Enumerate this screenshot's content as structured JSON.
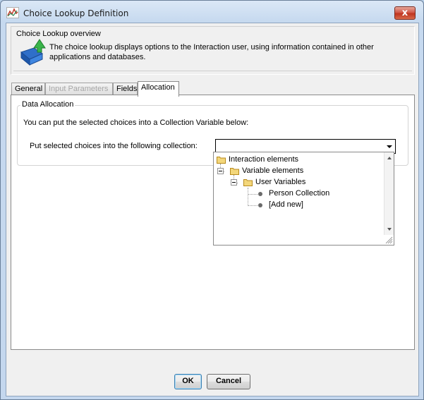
{
  "window": {
    "title": "Choice Lookup Definition",
    "close_glyph": "x"
  },
  "overview": {
    "title": "Choice Lookup overview",
    "text": "The choice lookup displays options to the Interaction user, using information contained in other applications and databases.",
    "icon": "lookup-arrow-icon"
  },
  "tabs": [
    {
      "label": "General",
      "state": "normal"
    },
    {
      "label": "Input Parameters",
      "state": "disabled"
    },
    {
      "label": "Fields",
      "state": "normal"
    },
    {
      "label": "Allocation",
      "state": "active"
    }
  ],
  "allocation": {
    "group_title": "Data Allocation",
    "description": "You can put the selected choices into a Collection Variable below:",
    "collection_label": "Put selected choices into the following collection:",
    "collection_value": ""
  },
  "tree": {
    "root": {
      "label": "Interaction elements",
      "icon": "folder-icon"
    },
    "variable_elements": {
      "label": "Variable elements",
      "icon": "folder-icon",
      "expanded": true
    },
    "user_variables": {
      "label": "User Variables",
      "icon": "folder-icon",
      "expanded": true
    },
    "items": [
      "Person Collection",
      "[Add new]"
    ]
  },
  "buttons": {
    "ok": "OK",
    "cancel": "Cancel"
  },
  "colors": {
    "title_bar": "#c6d9ef",
    "close_button": "#c8412b",
    "dialog_background": "#f0f0f0",
    "folder": "#e9c65a"
  }
}
